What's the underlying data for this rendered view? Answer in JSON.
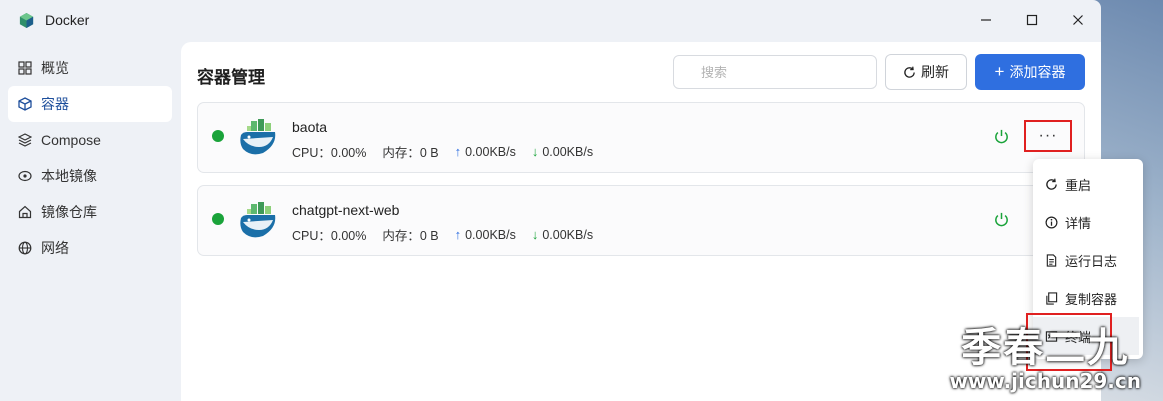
{
  "window": {
    "title": "Docker"
  },
  "sidebar": {
    "items": [
      {
        "label": "概览",
        "icon": "grid-icon"
      },
      {
        "label": "容器",
        "icon": "cube-icon",
        "active": true
      },
      {
        "label": "Compose",
        "icon": "layers-icon"
      },
      {
        "label": "本地镜像",
        "icon": "disk-icon"
      },
      {
        "label": "镜像仓库",
        "icon": "home-icon"
      },
      {
        "label": "网络",
        "icon": "globe-icon"
      }
    ]
  },
  "main": {
    "title": "容器管理",
    "search_placeholder": "搜索",
    "refresh_label": "刷新",
    "add_label": "添加容器",
    "accent_color": "#2f6fe0"
  },
  "containers": [
    {
      "name": "baota",
      "cpu": "CPU：0.00%",
      "mem": "内存：0 B",
      "up": "0.00KB/s",
      "down": "0.00KB/s",
      "status_color": "#1aa33a"
    },
    {
      "name": "chatgpt-next-web",
      "cpu": "CPU：0.00%",
      "mem": "内存：0 B",
      "up": "0.00KB/s",
      "down": "0.00KB/s",
      "status_color": "#1aa33a"
    }
  ],
  "more_label": "···",
  "menu": {
    "items": [
      {
        "label": "重启",
        "icon": "restart-icon"
      },
      {
        "label": "详情",
        "icon": "info-icon"
      },
      {
        "label": "运行日志",
        "icon": "log-icon"
      },
      {
        "label": "复制容器",
        "icon": "copy-icon"
      },
      {
        "label": "终端",
        "icon": "terminal-icon"
      }
    ]
  },
  "watermark": {
    "text": "季春二九",
    "url": "www.jichun29.cn"
  }
}
